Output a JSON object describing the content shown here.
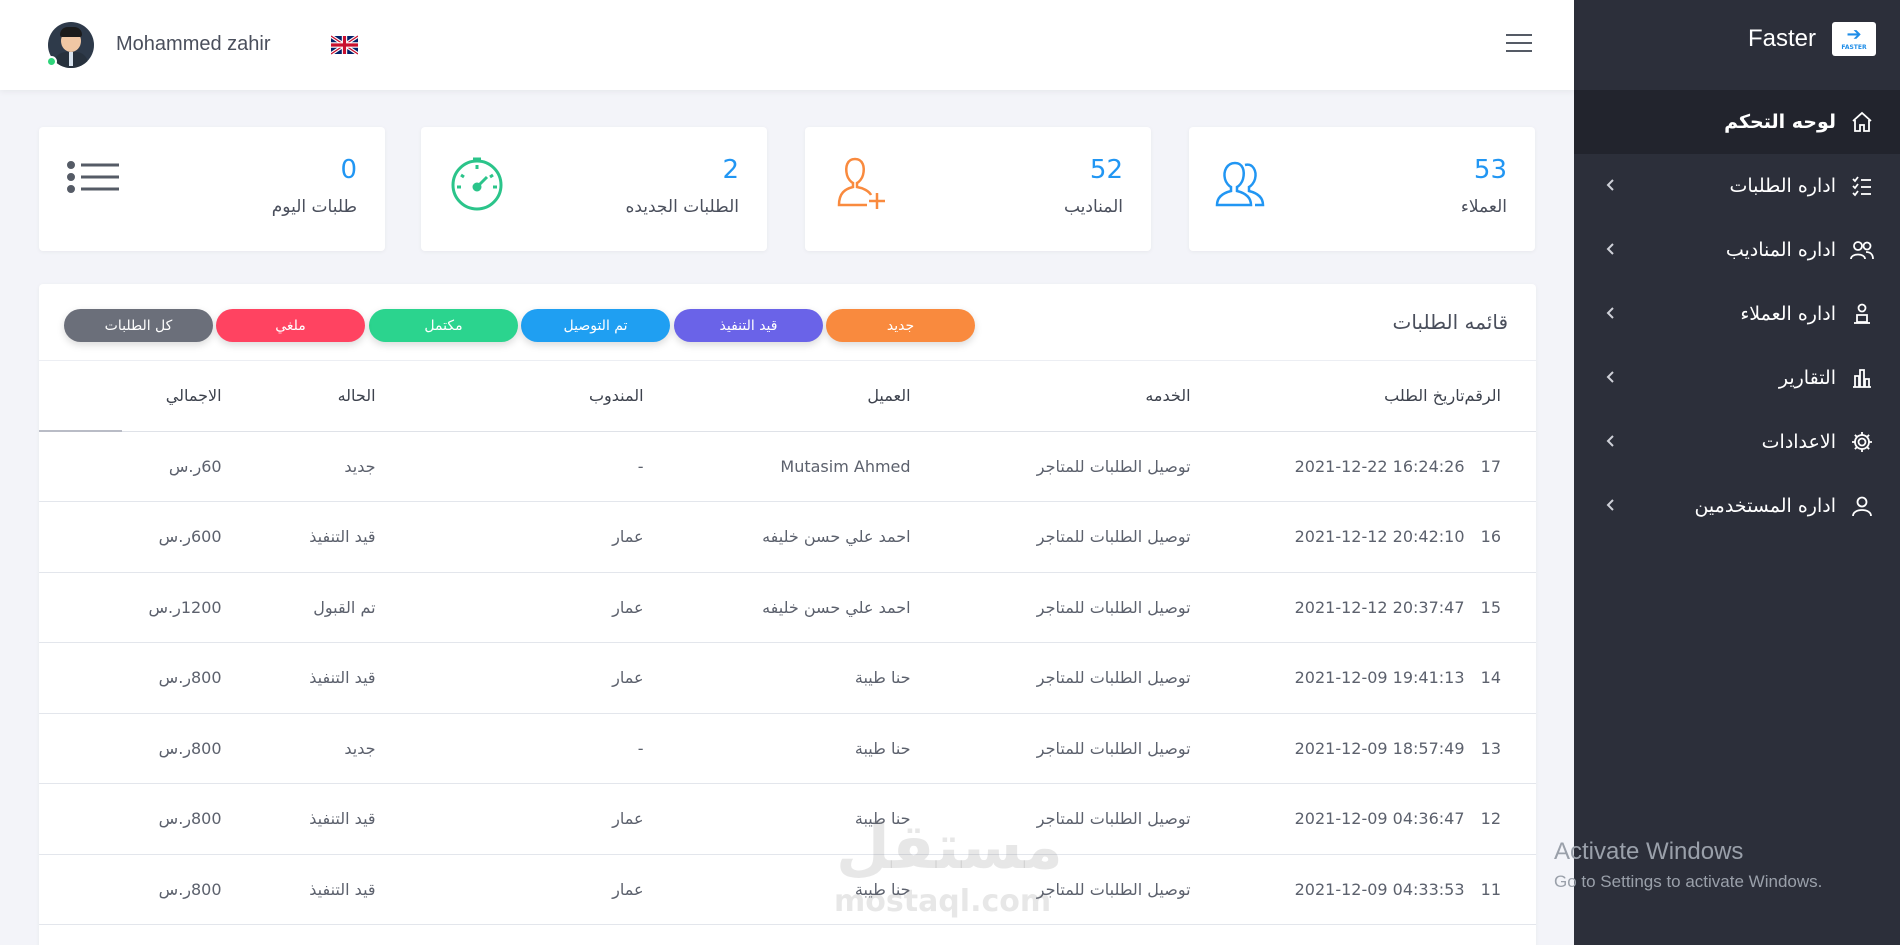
{
  "brand": {
    "name": "Faster",
    "logo_text": "FASTER"
  },
  "user": {
    "name": "Mohammed zahir",
    "language": "English (UK flag)"
  },
  "sidebar": {
    "items": [
      {
        "label": "لوحه التحكم",
        "icon": "home-icon",
        "active": true
      },
      {
        "label": "اداره الطلبات",
        "icon": "checklist-icon"
      },
      {
        "label": "اداره المناديب",
        "icon": "users-icon"
      },
      {
        "label": "اداره العملاء",
        "icon": "person-lock-icon"
      },
      {
        "label": "التقارير",
        "icon": "bar-chart-icon"
      },
      {
        "label": "الاعدادات",
        "icon": "gear-icon"
      },
      {
        "label": "اداره المستخدمين",
        "icon": "user-icon"
      }
    ]
  },
  "stats": [
    {
      "value": "53",
      "label": "العملاء",
      "icon": "users-outline-icon",
      "color": "#2196f3"
    },
    {
      "value": "52",
      "label": "المناديب",
      "icon": "user-add-icon",
      "color": "#f98a3e"
    },
    {
      "value": "2",
      "label": "الطلبات الجديده",
      "icon": "speedometer-icon",
      "color": "#2bc48a"
    },
    {
      "value": "0",
      "label": "طلبات اليوم",
      "icon": "list-icon",
      "color": "#555b66"
    }
  ],
  "orders": {
    "title": "قائمه الطلبات",
    "filters": [
      {
        "label": "جديد",
        "color": "#f98a3e"
      },
      {
        "label": "قيد التنفيذ",
        "color": "#6a63e8"
      },
      {
        "label": "تم التوصيل",
        "color": "#1f9ff2"
      },
      {
        "label": "مكتمل",
        "color": "#2bd48e"
      },
      {
        "label": "ملغي",
        "color": "#ff4361"
      },
      {
        "label": "كل الطلبات",
        "color": "#6b6f7a"
      }
    ],
    "columns": [
      "الرقم",
      "تاريخ الطلب",
      "الخدمه",
      "العميل",
      "المندوب",
      "الحاله",
      "الاجمالي"
    ],
    "rows": [
      [
        "17",
        "2021-12-22 16:24:26",
        "توصيل الطلبات للمتاجر",
        "Mutasim Ahmed",
        "-",
        "جديد",
        "60ر.س"
      ],
      [
        "16",
        "2021-12-12 20:42:10",
        "توصيل الطلبات للمتاجر",
        "احمد علي حسن خليفه",
        "عمار",
        "قيد التنفيذ",
        "600ر.س"
      ],
      [
        "15",
        "2021-12-12 20:37:47",
        "توصيل الطلبات للمتاجر",
        "احمد علي حسن خليفه",
        "عمار",
        "تم القبول",
        "1200ر.س"
      ],
      [
        "14",
        "2021-12-09 19:41:13",
        "توصيل الطلبات للمتاجر",
        "حنا طيبة",
        "عمار",
        "قيد التنفيذ",
        "800ر.س"
      ],
      [
        "13",
        "2021-12-09 18:57:49",
        "توصيل الطلبات للمتاجر",
        "حنا طيبة",
        "-",
        "جديد",
        "800ر.س"
      ],
      [
        "12",
        "2021-12-09 04:36:47",
        "توصيل الطلبات للمتاجر",
        "حنا طيبة",
        "عمار",
        "قيد التنفيذ",
        "800ر.س"
      ],
      [
        "11",
        "2021-12-09 04:33:53",
        "توصيل الطلبات للمتاجر",
        "حنا طيبة",
        "عمار",
        "قيد التنفيذ",
        "800ر.س"
      ]
    ]
  },
  "watermark": {
    "logo": "مستقل",
    "site": "mostaql.com"
  },
  "os_notice": {
    "title": "Activate Windows",
    "subtitle": "Go to Settings to activate Windows."
  }
}
